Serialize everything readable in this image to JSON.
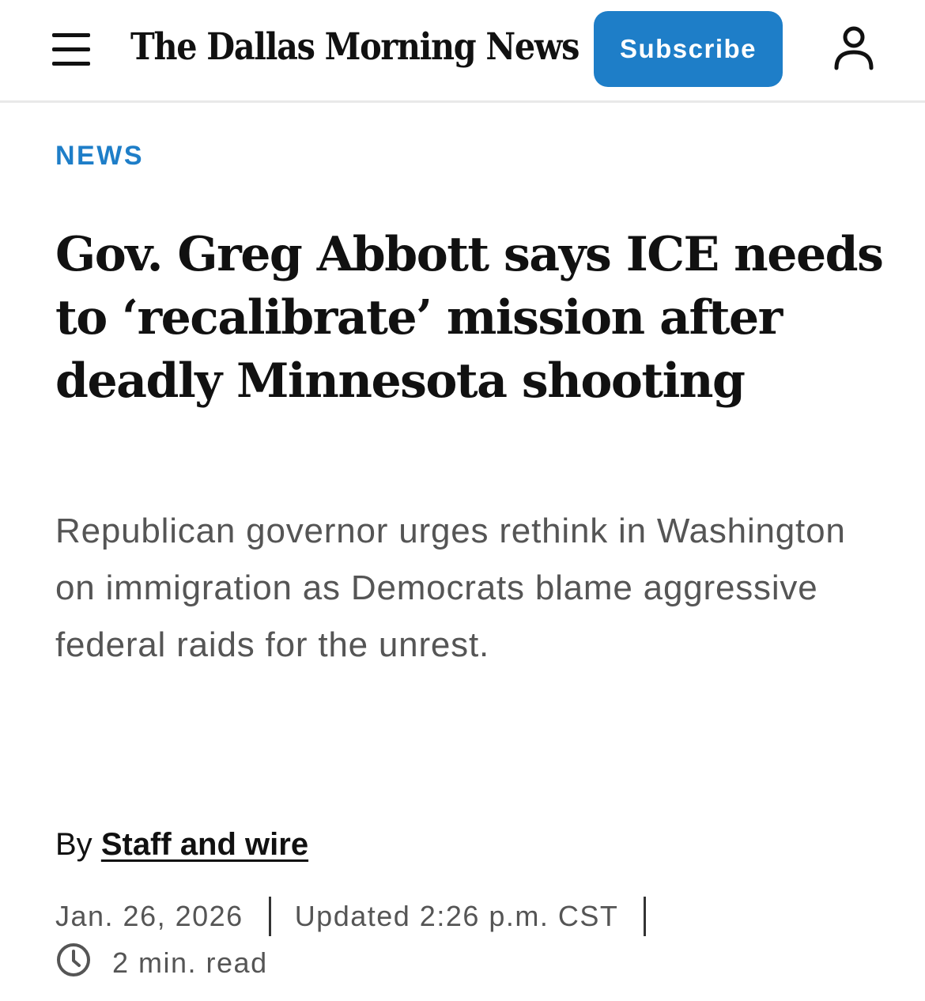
{
  "header": {
    "masthead": "The Dallas Morning News",
    "subscribe_label": "Subscribe",
    "icons": {
      "menu": "hamburger-menu-icon",
      "account": "user-account-icon"
    },
    "colors": {
      "accent": "#1e7ec8",
      "subscribe_text": "#ffffff"
    }
  },
  "article": {
    "section": "NEWS",
    "headline": "Gov. Greg Abbott says ICE needs to ‘recalibrate’ mission after deadly Minnesota shooting",
    "dek": "Republican governor urges rethink in Washington on immigration as Democrats blame aggressive federal raids for the unrest.",
    "byline_prefix": "By",
    "author": "Staff and wire",
    "date": "Jan. 26, 2026",
    "updated": "Updated 2:26 p.m. CST",
    "read_time": "2 min. read",
    "icons": {
      "read_time": "clock-icon"
    },
    "colors": {
      "section": "#1e7ec8",
      "headline": "#111111",
      "dek": "#555555",
      "meta": "#555555"
    }
  }
}
